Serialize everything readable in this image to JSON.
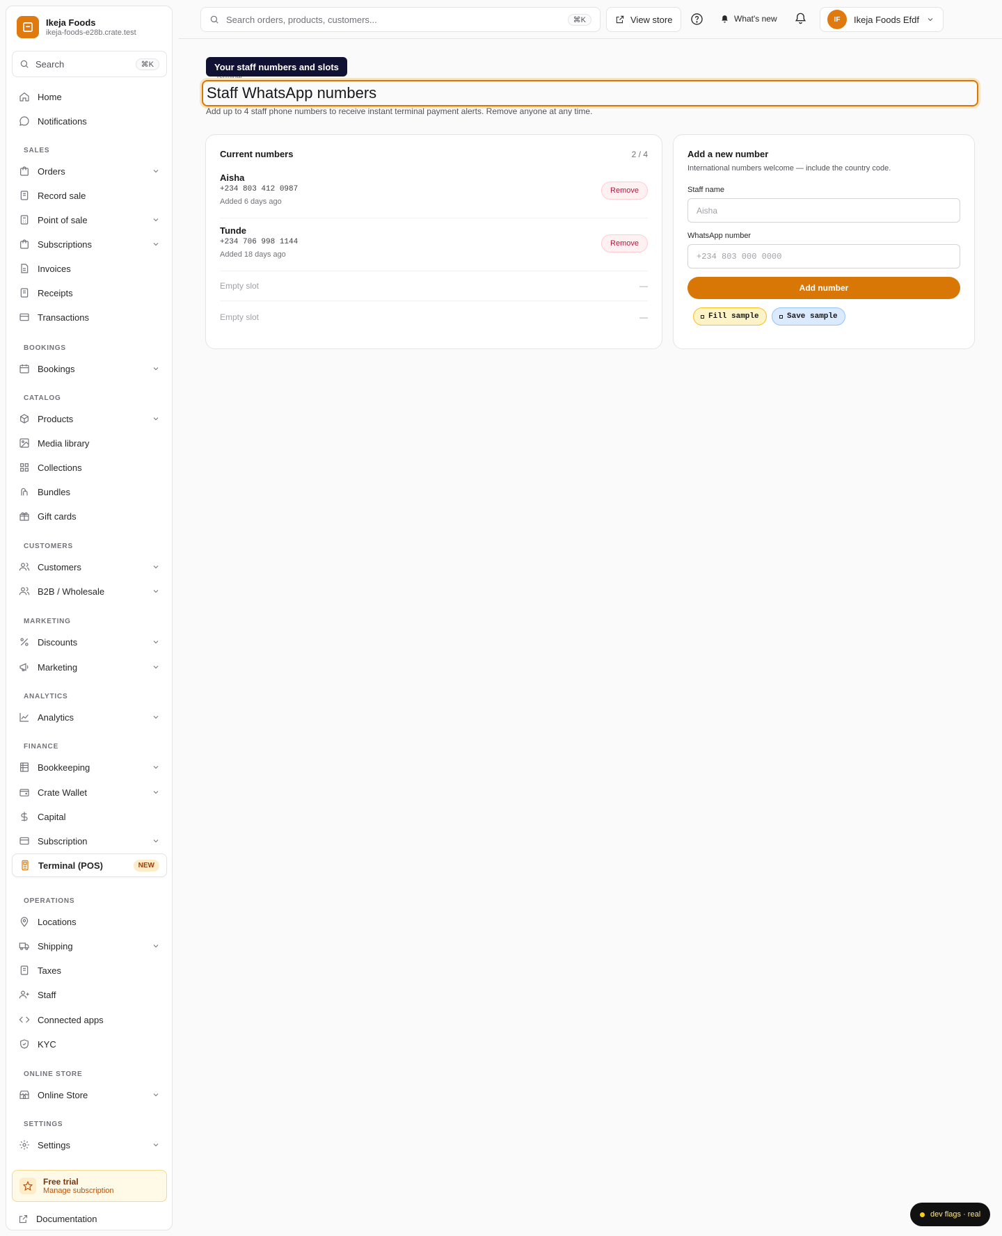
{
  "brand": {
    "name": "Ikeja Foods",
    "domain": "ikeja-foods-e28b.crate.test"
  },
  "sidebar": {
    "search": {
      "placeholder": "Search",
      "shortcut": "⌘K"
    },
    "sections": {
      "sales": "SALES",
      "bookings": "BOOKINGS",
      "catalog": "CATALOG",
      "customers": "CUSTOMERS",
      "marketing": "MARKETING",
      "analytics": "ANALYTICS",
      "finance": "FINANCE",
      "operations": "OPERATIONS",
      "online_store": "ONLINE STORE",
      "settings": "SETTINGS"
    },
    "items": {
      "home": "Home",
      "notifications": "Notifications",
      "orders": "Orders",
      "record_sale": "Record sale",
      "point_of_sale": "Point of sale",
      "subscriptions": "Subscriptions",
      "invoices": "Invoices",
      "receipts": "Receipts",
      "transactions": "Transactions",
      "bookings": "Bookings",
      "products": "Products",
      "media_library": "Media library",
      "collections": "Collections",
      "bundles": "Bundles",
      "gift_cards": "Gift cards",
      "customers": "Customers",
      "b2b": "B2B / Wholesale",
      "discounts": "Discounts",
      "marketing": "Marketing",
      "analytics": "Analytics",
      "bookkeeping": "Bookkeeping",
      "crate_wallet": "Crate Wallet",
      "capital": "Capital",
      "subscription": "Subscription",
      "terminal": "Terminal (POS)",
      "terminal_badge": "NEW",
      "locations": "Locations",
      "shipping": "Shipping",
      "taxes": "Taxes",
      "staff": "Staff",
      "connected_apps": "Connected apps",
      "kyc": "KYC",
      "online_store": "Online Store",
      "settings": "Settings"
    },
    "trial": {
      "title": "Free trial",
      "subtitle": "Manage subscription"
    },
    "documentation": "Documentation"
  },
  "topbar": {
    "search_placeholder": "Search orders, products, customers...",
    "search_shortcut": "⌘K",
    "view_store": "View store",
    "whats_new": "What's new",
    "account": {
      "initials": "IF",
      "name": "Ikeja Foods Efdf"
    }
  },
  "page": {
    "tooltip": "Your staff numbers and slots",
    "breadcrumb": "Terminal",
    "title": "Staff WhatsApp numbers",
    "subtitle": "Add up to 4 staff phone numbers to receive instant terminal payment alerts. Remove anyone at any time."
  },
  "current": {
    "title": "Current numbers",
    "count": "2 / 4",
    "numbers": [
      {
        "name": "Aisha",
        "phone": "+234 803 412 0987",
        "added": "Added 6 days ago",
        "action": "Remove"
      },
      {
        "name": "Tunde",
        "phone": "+234 706 998 1144",
        "added": "Added 18 days ago",
        "action": "Remove"
      }
    ],
    "empty_slots": [
      {
        "label": "Empty slot",
        "dash": "—"
      },
      {
        "label": "Empty slot",
        "dash": "—"
      }
    ]
  },
  "form": {
    "title": "Add a new number",
    "subtitle": "International numbers welcome — include the country code.",
    "name_label": "Staff name",
    "name_placeholder": "Aisha",
    "name_value": "",
    "phone_label": "WhatsApp number",
    "phone_placeholder": "+234 803 000 0000",
    "phone_value": "",
    "submit": "Add number",
    "fill_sample": "Fill sample",
    "save_sample": "Save sample"
  },
  "dev_pill": "dev flags · real",
  "colors": {
    "accent": "#d97706",
    "danger": "#be123c"
  }
}
